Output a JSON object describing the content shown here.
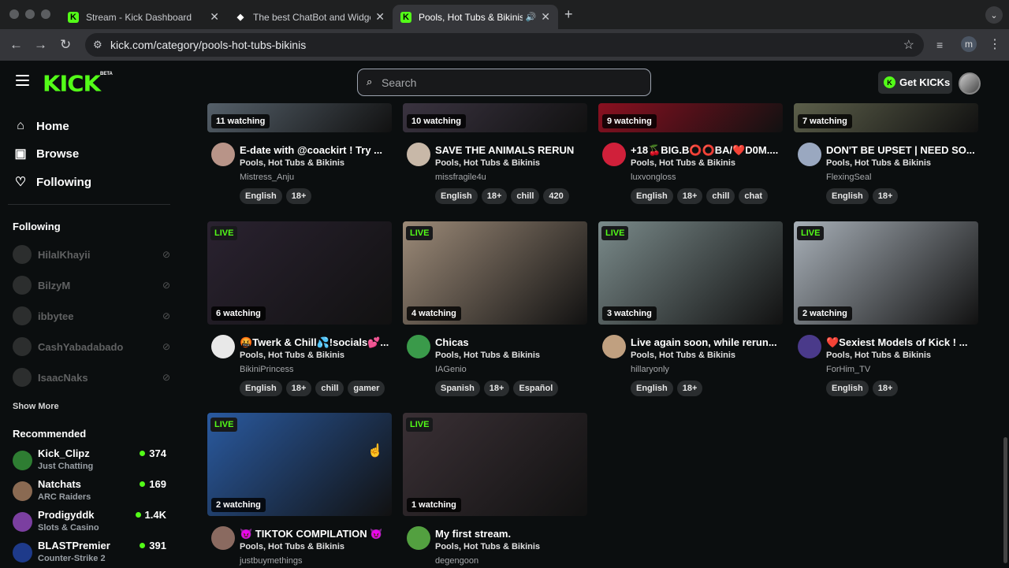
{
  "browser": {
    "tabs": [
      {
        "title": "Stream - Kick Dashboard",
        "icon": "kick-favicon"
      },
      {
        "title": "The best ChatBot and Widget",
        "icon": "diamond-favicon"
      },
      {
        "title": "Pools, Hot Tubs & Bikinis",
        "icon": "kick-favicon"
      }
    ],
    "url": "kick.com/category/pools-hot-tubs-bikinis",
    "profile_initial": "m"
  },
  "header": {
    "logo": "KICK",
    "beta": "BETA",
    "search_placeholder": "Search",
    "get_kicks": "Get KICKs",
    "brand_color": "#53fc18"
  },
  "sidebar": {
    "nav": [
      {
        "label": "Home",
        "icon": "home-icon"
      },
      {
        "label": "Browse",
        "icon": "browse-icon"
      },
      {
        "label": "Following",
        "icon": "heart-icon"
      }
    ],
    "following_heading": "Following",
    "following": [
      "HilalKhayii",
      "BilzyM",
      "ibbytee",
      "CashYabadabado",
      "IsaacNaks"
    ],
    "show_more": "Show More",
    "recommended_heading": "Recommended",
    "recommended": [
      {
        "name": "Kick_Clipz",
        "category": "Just Chatting",
        "viewers": "374",
        "color": "#2e7d32"
      },
      {
        "name": "Natchats",
        "category": "ARC Raiders",
        "viewers": "169",
        "color": "#8a6a52"
      },
      {
        "name": "Prodigyddk",
        "category": "Slots & Casino",
        "viewers": "1.4K",
        "color": "#7b3fa0"
      },
      {
        "name": "BLASTPremier",
        "category": "Counter-Strike 2",
        "viewers": "391",
        "color": "#1e3a8a"
      }
    ]
  },
  "cards": [
    {
      "watching": "11 watching",
      "title": "E-date with @coackirt ! Try ...",
      "category": "Pools, Hot Tubs & Bikinis",
      "user": "Mistress_Anju",
      "tags": [
        "English",
        "18+"
      ],
      "live": "",
      "thumb": "#55606a",
      "avatar": "#b89488"
    },
    {
      "watching": "10 watching",
      "title": "SAVE THE ANIMALS RERUN",
      "category": "Pools, Hot Tubs & Bikinis",
      "user": "missfragile4u",
      "tags": [
        "English",
        "18+",
        "chill",
        "420"
      ],
      "live": "",
      "thumb": "#3a3340",
      "avatar": "#c8b8a8"
    },
    {
      "watching": "9 watching",
      "title": "+18🍒BIG.B⭕⭕BA/❤️D0M....",
      "category": "Pools, Hot Tubs & Bikinis",
      "user": "luxvongloss",
      "tags": [
        "English",
        "18+",
        "chill",
        "chat"
      ],
      "live": "",
      "thumb": "#8a1020",
      "avatar": "#d0203a"
    },
    {
      "watching": "7 watching",
      "title": "DON'T BE UPSET | NEED SO...",
      "category": "Pools, Hot Tubs & Bikinis",
      "user": "FlexingSeal",
      "tags": [
        "English",
        "18+"
      ],
      "live": "",
      "thumb": "#5c5f4a",
      "avatar": "#9aa8c0"
    },
    {
      "watching": "6 watching",
      "title": "🤬Twerk & Chill💦!socials💕...",
      "category": "Pools, Hot Tubs & Bikinis",
      "user": "BikiniPrincess",
      "tags": [
        "English",
        "18+",
        "chill",
        "gamer"
      ],
      "live": "LIVE",
      "thumb": "#2a2230",
      "avatar": "#e8e8e8"
    },
    {
      "watching": "4 watching",
      "title": "Chicas",
      "category": "Pools, Hot Tubs & Bikinis",
      "user": "IAGenio",
      "tags": [
        "Spanish",
        "18+",
        "Español"
      ],
      "live": "LIVE",
      "thumb": "#9c8a78",
      "avatar": "#3a9a4a"
    },
    {
      "watching": "3 watching",
      "title": "Live again soon, while rerun...",
      "category": "Pools, Hot Tubs & Bikinis",
      "user": "hillaryonly",
      "tags": [
        "English",
        "18+"
      ],
      "live": "LIVE",
      "thumb": "#7a8a8a",
      "avatar": "#c0a080"
    },
    {
      "watching": "2 watching",
      "title": "❤️Sexiest Models of Kick ! ...",
      "category": "Pools, Hot Tubs & Bikinis",
      "user": "ForHim_TV",
      "tags": [
        "English",
        "18+"
      ],
      "live": "LIVE",
      "thumb": "#a8b0b8",
      "avatar": "#4a3a8a"
    },
    {
      "watching": "2 watching",
      "title": "😈 TIKTOK COMPILATION 😈",
      "category": "Pools, Hot Tubs & Bikinis",
      "user": "justbuymethings",
      "tags": [],
      "live": "LIVE",
      "thumb": "#2a5aa0",
      "avatar": "#8a6a60"
    },
    {
      "watching": "1 watching",
      "title": "My first stream.",
      "category": "Pools, Hot Tubs & Bikinis",
      "user": "degengoon",
      "tags": [],
      "live": "LIVE",
      "thumb": "#3a3035",
      "avatar": "#53a040"
    }
  ]
}
